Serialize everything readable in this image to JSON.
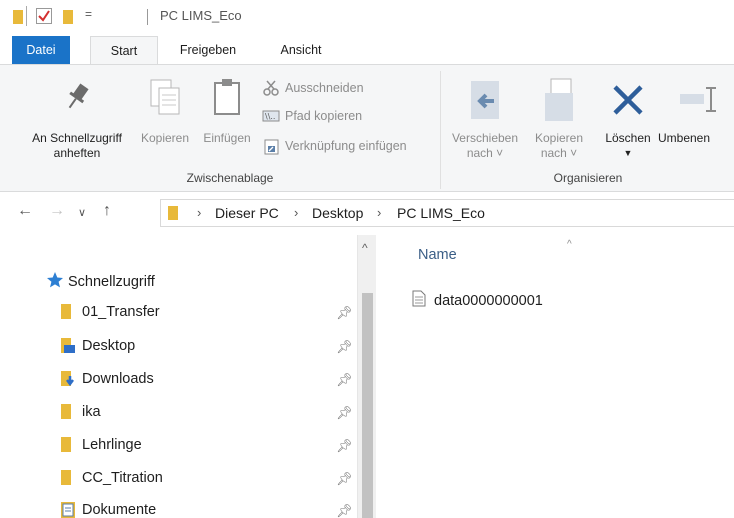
{
  "window": {
    "title": "PC LIMS_Eco"
  },
  "ribbon_tabs": {
    "file": "Datei",
    "start": "Start",
    "share": "Freigeben",
    "view": "Ansicht"
  },
  "clipboard": {
    "pin_label_1": "An Schnellzugriff",
    "pin_label_2": "anheften",
    "copy_label": "Kopieren",
    "paste_label": "Einfügen",
    "cut_label": "Ausschneiden",
    "copy_path_label": "Pfad kopieren",
    "paste_shortcut_label": "Verknüpfung einfügen",
    "group_label": "Zwischenablage"
  },
  "organize": {
    "move_label_1": "Verschieben",
    "move_label_2": "nach ˅",
    "copyto_label_1": "Kopieren",
    "copyto_label_2": "nach ˅",
    "delete_label": "Löschen",
    "rename_label": "Umbenen",
    "group_label": "Organisieren"
  },
  "address": {
    "crumbs": [
      "Dieser PC",
      "Desktop",
      "PC LIMS_Eco"
    ]
  },
  "nav_pane": {
    "quick_access": "Schnellzugriff",
    "items": [
      {
        "label": "01_Transfer",
        "icon": "folder-icon"
      },
      {
        "label": "Desktop",
        "icon": "desktop-folder-icon"
      },
      {
        "label": "Downloads",
        "icon": "downloads-folder-icon"
      },
      {
        "label": "ika",
        "icon": "folder-icon"
      },
      {
        "label": "Lehrlinge",
        "icon": "folder-icon"
      },
      {
        "label": "CC_Titration",
        "icon": "folder-icon"
      },
      {
        "label": "Dokumente",
        "icon": "documents-folder-icon"
      }
    ]
  },
  "content": {
    "column_header": "Name",
    "files": [
      {
        "name": "data0000000001",
        "icon": "text-file-icon"
      }
    ]
  },
  "colors": {
    "accent": "#1a73c8",
    "folder": "#e8b93a",
    "delete_x": "#2e5e9a"
  }
}
